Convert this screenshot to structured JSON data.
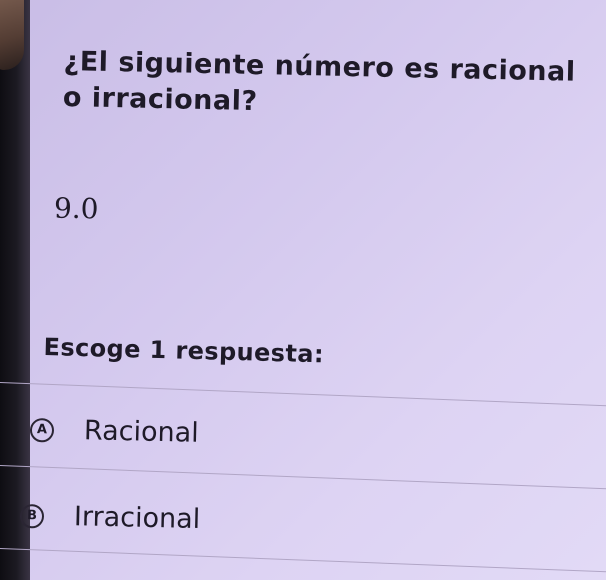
{
  "question": {
    "text": "¿El siguiente número es racional o irracional?",
    "number": "9.0"
  },
  "answer_prompt": "Escoge 1 respuesta:",
  "options": [
    {
      "letter": "A",
      "label": "Racional"
    },
    {
      "letter": "B",
      "label": "Irracional"
    }
  ],
  "colors": {
    "background": "#d4c9ee",
    "text": "#1e1a28",
    "divider": "#b1a6c6"
  }
}
